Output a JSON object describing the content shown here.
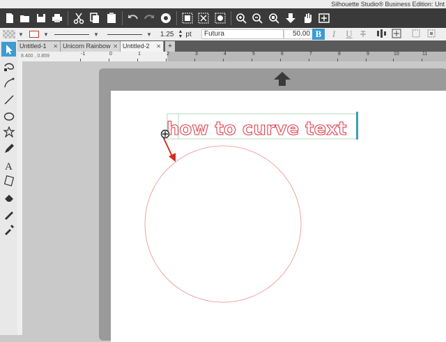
{
  "app": {
    "title": "Silhouette Studio® Business Edition: Unt"
  },
  "toolbar": {
    "icons": [
      "new-icon",
      "open-icon",
      "save-icon",
      "print-icon",
      "cut-icon",
      "copy-icon",
      "paste-icon",
      "undo-icon",
      "redo-icon",
      "replicate-icon",
      "group-icon",
      "ungroup-icon",
      "compound-icon",
      "zoom-in-icon",
      "zoom-out-icon",
      "zoom-select-icon",
      "move-down-icon",
      "pan-icon",
      "add-page-icon"
    ]
  },
  "properties": {
    "line_width": "1.25",
    "line_unit": "pt",
    "font": "Futura",
    "font_size": "50.00",
    "bold": "B",
    "italic": "I",
    "underline": "U"
  },
  "tabs": [
    {
      "label": "Untitled-1",
      "close": "✕",
      "active": false
    },
    {
      "label": "Unicorn Rainbow",
      "close": "✕",
      "active": false
    },
    {
      "label": "Untitled-2",
      "close": "✕",
      "active": true
    }
  ],
  "tab_add": "+",
  "ruler": {
    "coords": "8.400 , 0.859",
    "labels": [
      "-1",
      "0",
      "1",
      "2",
      "3",
      "4",
      "5",
      "6",
      "7",
      "8",
      "9",
      "10",
      "11"
    ]
  },
  "canvas": {
    "text": "how to curve text",
    "text_color": "#e04050",
    "circle_color": "#ef8a8a",
    "arrow_color": "#d03020",
    "selection_accent": "#3aa0b0"
  },
  "tools": [
    "select-tool-icon",
    "point-edit-icon",
    "curve-icon",
    "line-tool-icon",
    "ellipse-tool-icon",
    "polygon-tool-icon",
    "pencil-icon",
    "text-tool-icon",
    "fill-icon",
    "eraser-icon",
    "knife-icon",
    "eyedropper-icon"
  ]
}
